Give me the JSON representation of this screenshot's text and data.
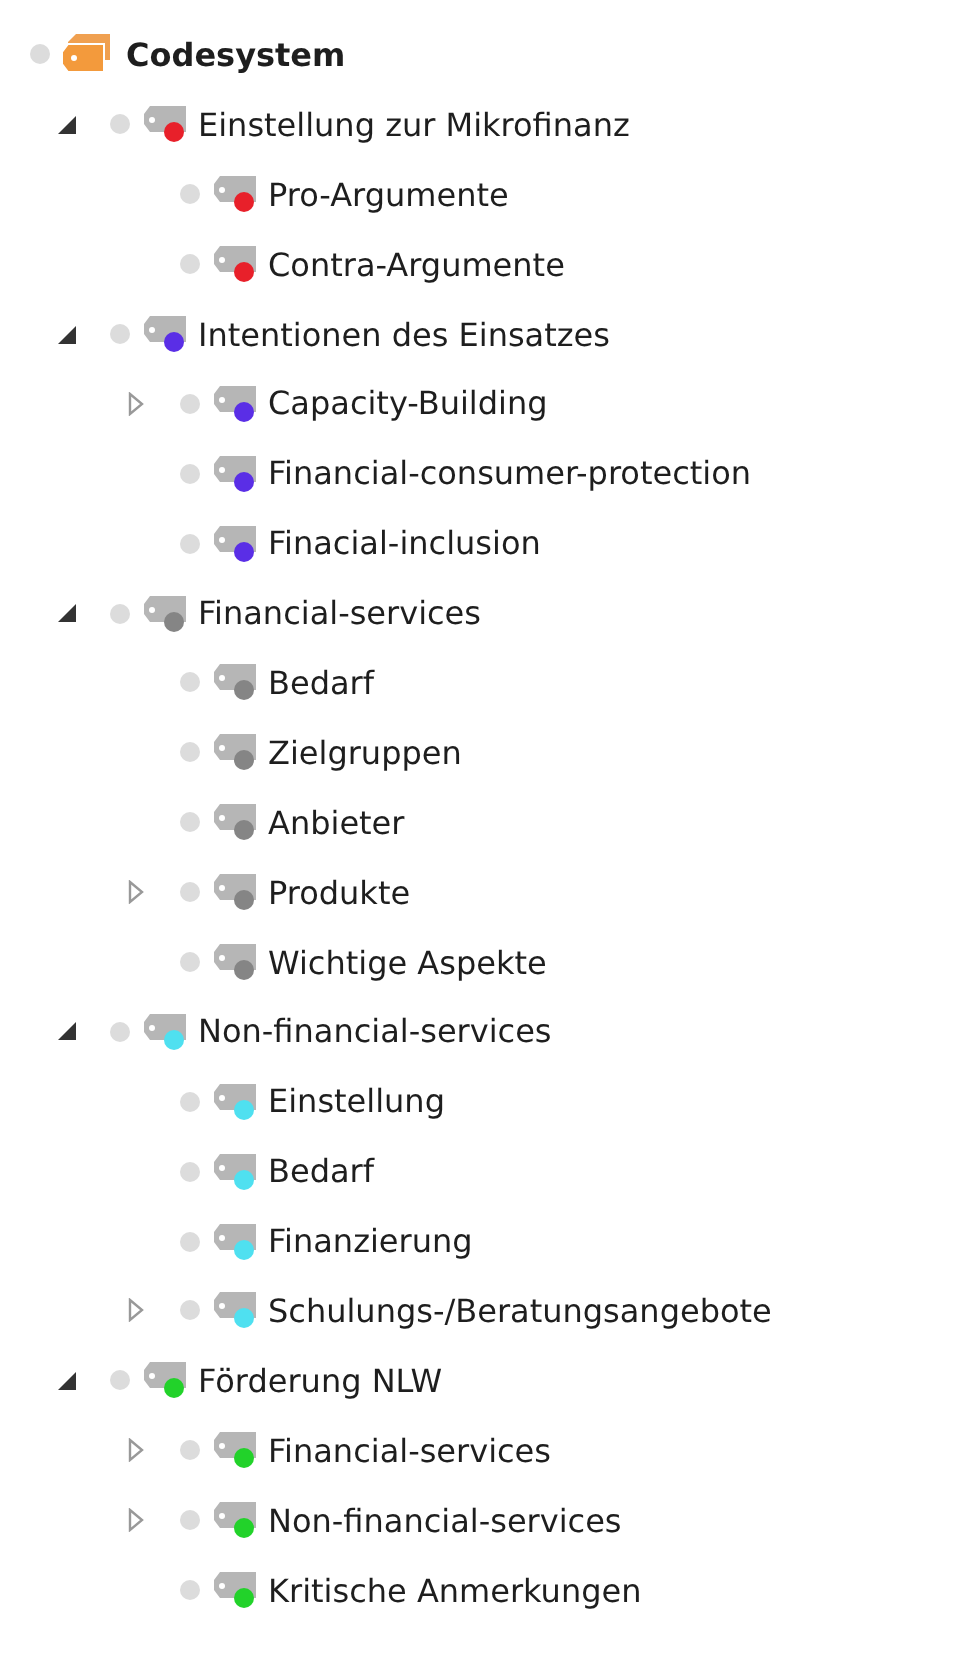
{
  "tree": {
    "label": "Codesystem",
    "children": [
      {
        "label": "Einstellung zur Mikrofinanz",
        "color": "#e8202a",
        "expanded": true,
        "children": [
          {
            "label": "Pro-Argumente",
            "color": "#e8202a"
          },
          {
            "label": "Contra-Argumente",
            "color": "#e8202a"
          }
        ]
      },
      {
        "label": "Intentionen des Einsatzes",
        "color": "#5a2ee6",
        "expanded": true,
        "children": [
          {
            "label": "Capacity-Building",
            "color": "#5a2ee6",
            "expanded": false
          },
          {
            "label": "Financial-consumer-protection",
            "color": "#5a2ee6"
          },
          {
            "label": "Finacial-inclusion",
            "color": "#5a2ee6"
          }
        ]
      },
      {
        "label": "Financial-services",
        "color": "#858585",
        "expanded": true,
        "children": [
          {
            "label": "Bedarf",
            "color": "#858585"
          },
          {
            "label": "Zielgruppen",
            "color": "#858585"
          },
          {
            "label": "Anbieter",
            "color": "#858585"
          },
          {
            "label": "Produkte",
            "color": "#858585",
            "expanded": false
          },
          {
            "label": "Wichtige Aspekte",
            "color": "#858585"
          }
        ]
      },
      {
        "label": "Non-financial-services",
        "color": "#4fe0f0",
        "expanded": true,
        "children": [
          {
            "label": "Einstellung",
            "color": "#4fe0f0"
          },
          {
            "label": "Bedarf",
            "color": "#4fe0f0"
          },
          {
            "label": "Finanzierung",
            "color": "#4fe0f0"
          },
          {
            "label": "Schulungs-/Beratungsangebote",
            "color": "#4fe0f0",
            "expanded": false
          }
        ]
      },
      {
        "label": "Förderung NLW",
        "color": "#22d22a",
        "expanded": true,
        "children": [
          {
            "label": "Financial-services",
            "color": "#22d22a",
            "expanded": false
          },
          {
            "label": "Non-financial-services",
            "color": "#22d22a",
            "expanded": false
          },
          {
            "label": "Kritische Anmerkungen",
            "color": "#22d22a"
          }
        ]
      }
    ]
  }
}
